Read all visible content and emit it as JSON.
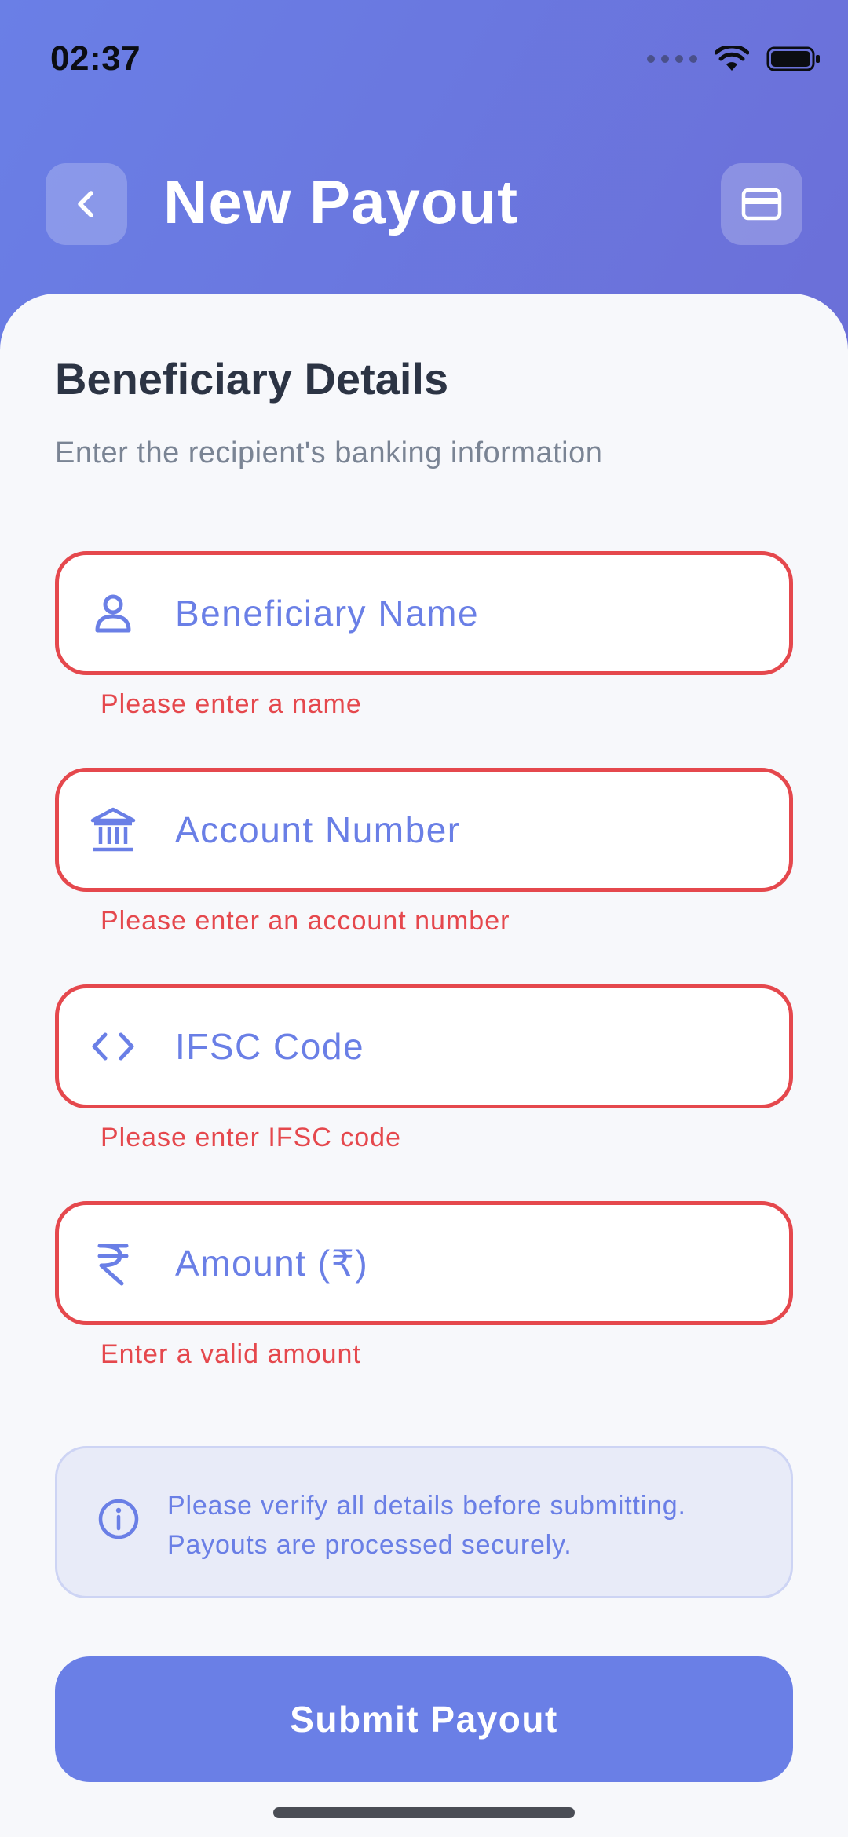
{
  "status_bar": {
    "time": "02:37",
    "icons": [
      "cellular-dots-icon",
      "wifi-icon",
      "battery-icon"
    ]
  },
  "header": {
    "title": "New Payout",
    "back_icon": "chevron-left-icon",
    "right_icon": "credit-card-icon"
  },
  "section": {
    "title": "Beneficiary Details",
    "subtitle": "Enter the recipient's banking information"
  },
  "fields": [
    {
      "placeholder": "Beneficiary Name",
      "value": "",
      "icon": "person-icon",
      "error": "Please enter a name"
    },
    {
      "placeholder": "Account Number",
      "value": "",
      "icon": "bank-icon",
      "error": "Please enter an account number"
    },
    {
      "placeholder": "IFSC Code",
      "value": "",
      "icon": "code-icon",
      "error": "Please enter IFSC code"
    },
    {
      "placeholder": "Amount (₹)",
      "value": "",
      "icon": "rupee-icon",
      "error": "Enter a valid amount"
    }
  ],
  "info": {
    "icon": "info-icon",
    "line1": "Please verify all details before submitting.",
    "line2": "Payouts are processed securely."
  },
  "submit": {
    "label": "Submit Payout"
  },
  "colors": {
    "accent": "#6a7fe6",
    "error": "#e5484d",
    "heading": "#2c3444",
    "muted": "#7a8494",
    "info_bg": "#e8ebf8"
  }
}
